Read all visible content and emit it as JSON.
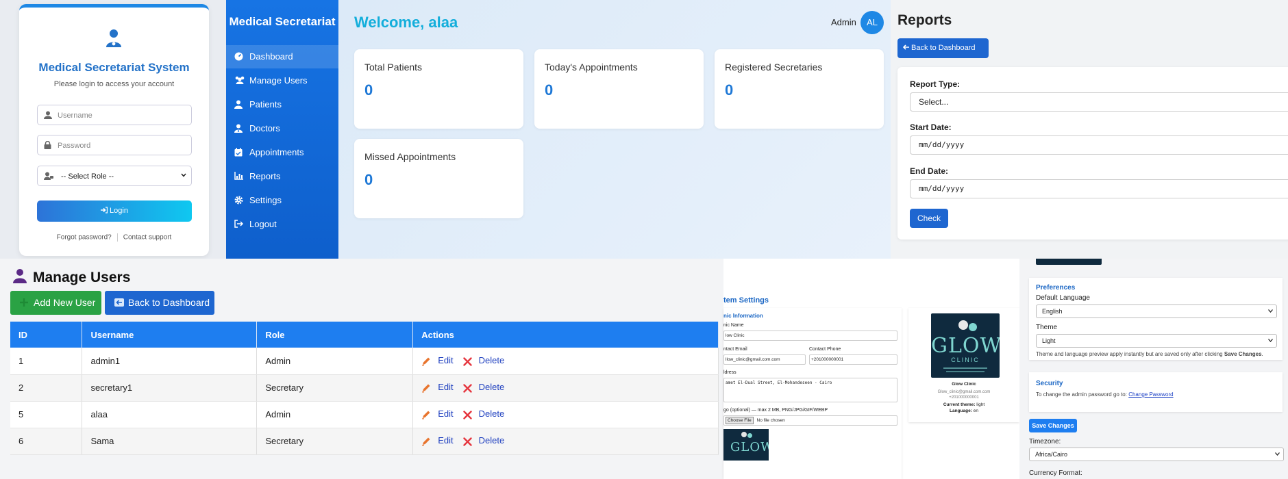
{
  "login": {
    "title": "Medical Secretariat System",
    "subtitle": "Please login to access your account",
    "username_placeholder": "Username",
    "password_placeholder": "Password",
    "role_value": "-- Select Role --",
    "login_label": "Login",
    "forgot": "Forgot password?",
    "contact": "Contact support"
  },
  "dashboard": {
    "brand": "Medical Secretariat",
    "welcome": "Welcome, alaa",
    "user_label": "Admin",
    "avatar": "AL",
    "nav": [
      {
        "label": "Dashboard",
        "icon": "dashboard-icon",
        "active": true
      },
      {
        "label": "Manage Users",
        "icon": "users-icon"
      },
      {
        "label": "Patients",
        "icon": "patient-icon"
      },
      {
        "label": "Doctors",
        "icon": "doctor-icon"
      },
      {
        "label": "Appointments",
        "icon": "calendar-icon"
      },
      {
        "label": "Reports",
        "icon": "chart-icon"
      },
      {
        "label": "Settings",
        "icon": "gear-icon"
      },
      {
        "label": "Logout",
        "icon": "logout-icon"
      }
    ],
    "stats": [
      {
        "label": "Total Patients",
        "value": "0"
      },
      {
        "label": "Today's Appointments",
        "value": "0"
      },
      {
        "label": "Registered Secretaries",
        "value": "0"
      },
      {
        "label": "Missed Appointments",
        "value": "0"
      }
    ]
  },
  "reports": {
    "title": "Reports",
    "back": "Back to Dashboard",
    "type_label": "Report Type:",
    "type_value": "Select...",
    "start_label": "Start Date:",
    "start_placeholder": "mm/dd/yyyy",
    "end_label": "End Date:",
    "end_placeholder": "mm/dd/yyyy",
    "check": "Check"
  },
  "manage_users": {
    "title": "Manage Users",
    "add": "Add New User",
    "back": "Back to Dashboard",
    "columns": [
      "ID",
      "Username",
      "Role",
      "Actions"
    ],
    "edit": "Edit",
    "delete": "Delete",
    "rows": [
      {
        "id": "1",
        "username": "admin1",
        "role": "Admin"
      },
      {
        "id": "2",
        "username": "secretary1",
        "role": "Secretary"
      },
      {
        "id": "5",
        "username": "alaa",
        "role": "Admin"
      },
      {
        "id": "6",
        "username": "Sama",
        "role": "Secretary"
      }
    ]
  },
  "system_settings": {
    "title": "tem Settings",
    "section": "nic Information",
    "name_label": "nic Name",
    "name_value": "low Clinic",
    "email_label": "ntact Email",
    "email_value": "llow_clinic@gmail.com.com",
    "phone_label": "Contact Phone",
    "phone_value": "+201000000001",
    "address_label": "ldress",
    "address_value": "amet El-Dual Street, El-Mohandeseen - Cairo",
    "logo_label": "go (optional) — max 2 MB, PNG/JPG/GIF/WEBP",
    "file_button": "Choose File",
    "file_status": "No file chosen",
    "preview": {
      "logo_text": "GLOW",
      "logo_sub": "CLINIC",
      "name": "Glow Clinic",
      "email": "Glow_clinic@gmail.com.com",
      "phone": "+201000000001",
      "theme_label": "Current theme:",
      "theme_value": "light",
      "lang_label": "Language:",
      "lang_value": "en"
    }
  },
  "preferences": {
    "title": "Preferences",
    "lang_label": "Default Language",
    "lang_value": "English",
    "theme_label": "Theme",
    "theme_value": "Light",
    "note_pre": "Theme and language preview apply instantly but are saved only after clicking ",
    "note_bold": "Save Changes",
    "note_post": ".",
    "security_title": "Security",
    "security_text": "To change the admin password go to: ",
    "security_link": "Change Password",
    "save": "Save Changes",
    "timezone_label": "Timezone:",
    "timezone_value": "Africa/Cairo",
    "currency_label": "Currency Format:"
  },
  "colors": {
    "primary": "#1e7ef0",
    "success": "#2aa244",
    "danger": "#e5343d",
    "welcome": "#13aedb"
  }
}
